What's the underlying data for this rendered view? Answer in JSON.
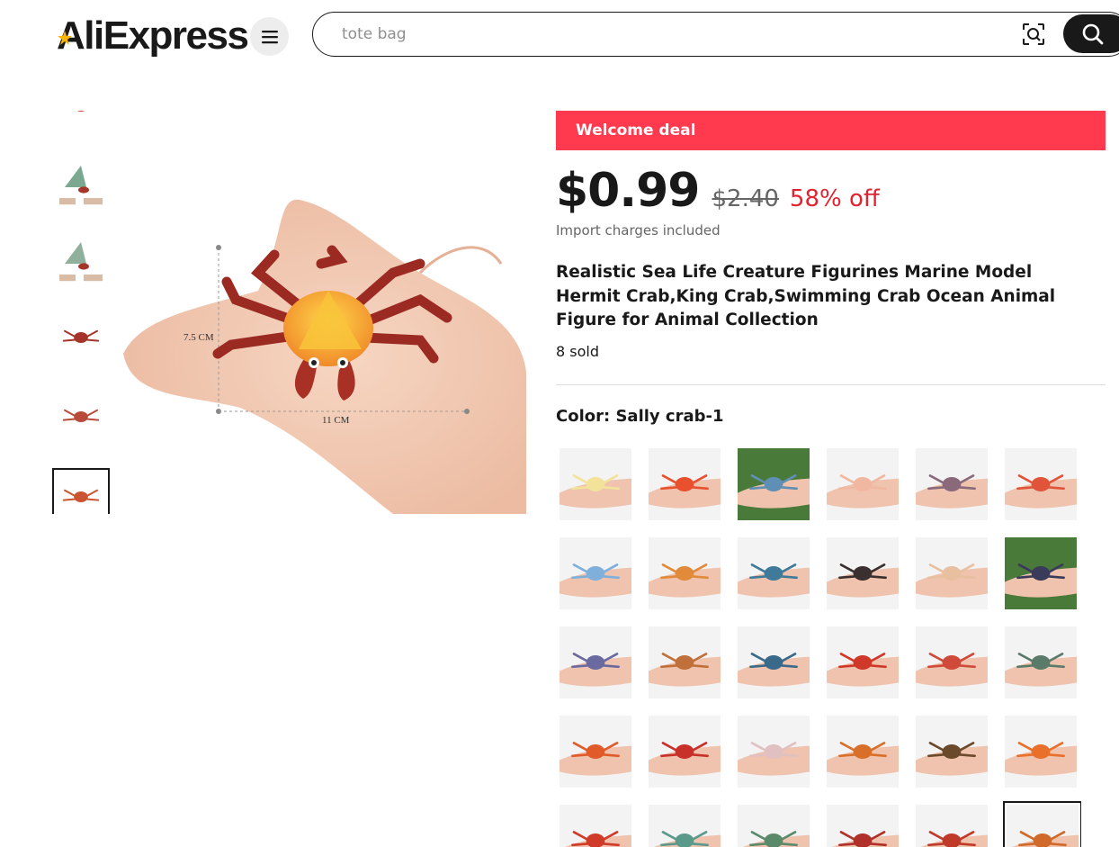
{
  "header": {
    "logo_text": "AliExpress",
    "search_value": "",
    "search_placeholder": "tote bag"
  },
  "icons": [
    "menu-icon",
    "image-search-icon",
    "search-icon"
  ],
  "product": {
    "deal_banner": "Welcome deal",
    "price": "$0.99",
    "original_price": "$2.40",
    "discount": "58% off",
    "import_note": "Import charges included",
    "title": "Realistic Sea Life Creature Figurines Marine Model Hermit Crab,King Crab,Swimming Crab Ocean Animal Figure for Animal Collection",
    "sold": "8 sold",
    "color_label": "Color: Sally crab-1"
  },
  "main_image": {
    "dimension_height": "7.5 CM",
    "dimension_width": "11 CM"
  },
  "thumbnails": [
    {
      "kind": "crab",
      "color": "#b5402d"
    },
    {
      "kind": "hermit",
      "color": "#7aa890"
    },
    {
      "kind": "hermit",
      "color": "#8fb09a"
    },
    {
      "kind": "crab",
      "color": "#a5352a"
    },
    {
      "kind": "crab",
      "color": "#b84a3a"
    },
    {
      "kind": "crab",
      "color": "#c9542f",
      "selected": true
    }
  ],
  "swatches": [
    {
      "color": "#f2e29a",
      "bg": "#f3f3f3"
    },
    {
      "color": "#e8502e",
      "bg": "#f3f3f3"
    },
    {
      "color": "#5f8fb5",
      "bg": "#4a7a3a"
    },
    {
      "color": "#f0b8a0",
      "bg": "#f3f3f3"
    },
    {
      "color": "#8a6a7a",
      "bg": "#f3f3f3"
    },
    {
      "color": "#e0553a",
      "bg": "#f3f3f3"
    },
    {
      "color": "#7fb0dc",
      "bg": "#f3f3f3"
    },
    {
      "color": "#e08a3a",
      "bg": "#f3f3f3"
    },
    {
      "color": "#3f7a9a",
      "bg": "#f3f3f3"
    },
    {
      "color": "#3a3030",
      "bg": "#f3f3f3"
    },
    {
      "color": "#e8c0a0",
      "bg": "#f3f3f3"
    },
    {
      "color": "#3a3a5a",
      "bg": "#4a7a3a"
    },
    {
      "color": "#6a6aa0",
      "bg": "#f3f3f3"
    },
    {
      "color": "#c0703a",
      "bg": "#f3f3f3"
    },
    {
      "color": "#3a6a8a",
      "bg": "#f3f3f3"
    },
    {
      "color": "#d0382a",
      "bg": "#f3f3f3"
    },
    {
      "color": "#d04a3a",
      "bg": "#f3f3f3"
    },
    {
      "color": "#5a7a6a",
      "bg": "#f3f3f3"
    },
    {
      "color": "#e05a2a",
      "bg": "#f3f3f3"
    },
    {
      "color": "#c8302a",
      "bg": "#f3f3f3"
    },
    {
      "color": "#e0c0c0",
      "bg": "#f3f3f3"
    },
    {
      "color": "#d8702a",
      "bg": "#f3f3f3"
    },
    {
      "color": "#6a4a2a",
      "bg": "#f3f3f3"
    },
    {
      "color": "#e8702a",
      "bg": "#f3f3f3"
    },
    {
      "color": "#d03a2a",
      "bg": "#f3f3f3"
    },
    {
      "color": "#5a9a8a",
      "bg": "#f3f3f3"
    },
    {
      "color": "#5a8a6a",
      "bg": "#f3f3f3"
    },
    {
      "color": "#b0302a",
      "bg": "#f3f3f3"
    },
    {
      "color": "#c03a2a",
      "bg": "#f3f3f3"
    },
    {
      "color": "#d06a2a",
      "bg": "#f3f3f3",
      "selected": true
    }
  ],
  "colors": {
    "deal_red": "#ff3a4f",
    "discount_red": "#e0232e",
    "text": "#191919"
  }
}
